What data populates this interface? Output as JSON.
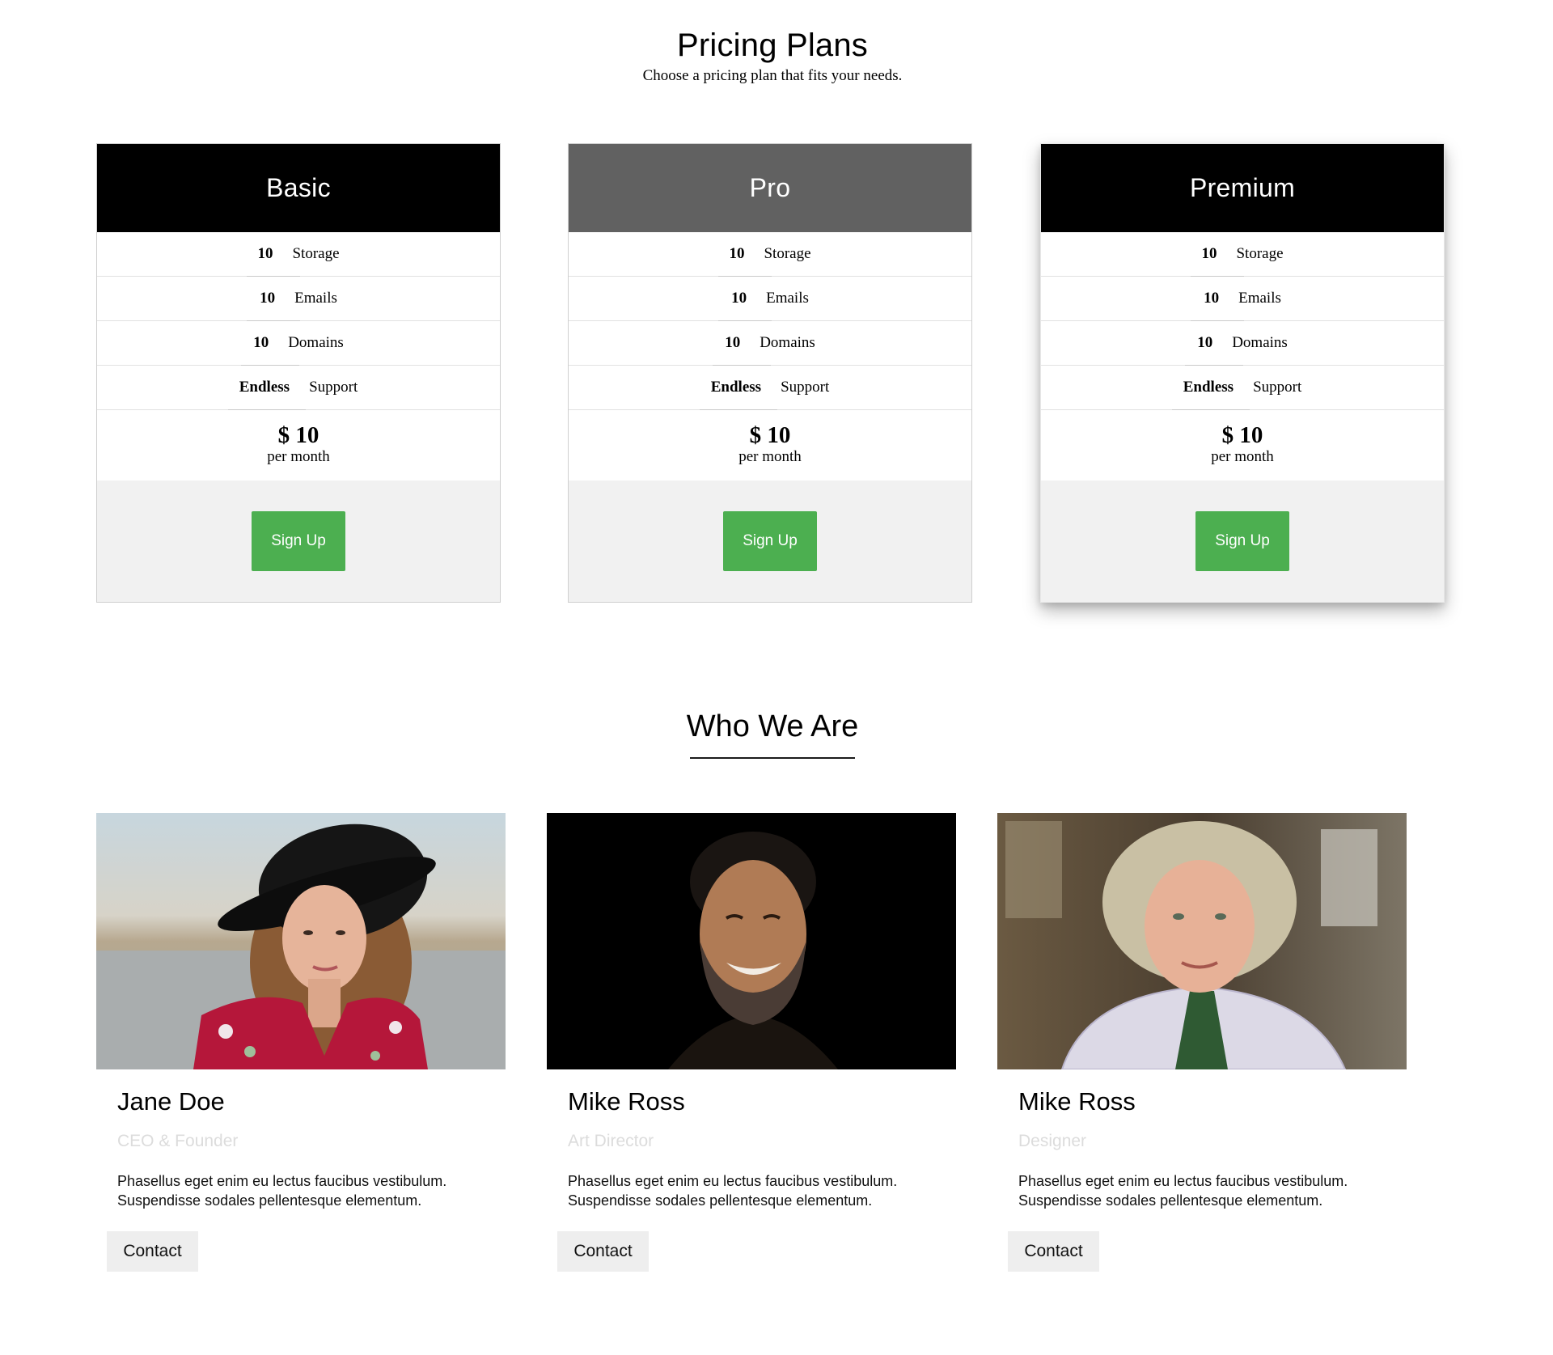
{
  "pricing": {
    "title": "Pricing Plans",
    "subtitle": "Choose a pricing plan that fits your needs.",
    "plans": [
      {
        "name": "Basic",
        "features": [
          {
            "value": "10",
            "label": "Storage"
          },
          {
            "value": "10",
            "label": "Emails"
          },
          {
            "value": "10",
            "label": "Domains"
          },
          {
            "value": "Endless",
            "label": "Support"
          }
        ],
        "price": "$ 10",
        "period": "per month",
        "button": "Sign Up"
      },
      {
        "name": "Pro",
        "features": [
          {
            "value": "10",
            "label": "Storage"
          },
          {
            "value": "10",
            "label": "Emails"
          },
          {
            "value": "10",
            "label": "Domains"
          },
          {
            "value": "Endless",
            "label": "Support"
          }
        ],
        "price": "$ 10",
        "period": "per month",
        "button": "Sign Up"
      },
      {
        "name": "Premium",
        "features": [
          {
            "value": "10",
            "label": "Storage"
          },
          {
            "value": "10",
            "label": "Emails"
          },
          {
            "value": "10",
            "label": "Domains"
          },
          {
            "value": "Endless",
            "label": "Support"
          }
        ],
        "price": "$ 10",
        "period": "per month",
        "button": "Sign Up"
      }
    ],
    "colors": {
      "header_dark": "#000000",
      "header_pro": "#616161",
      "button": "#4caf50",
      "footer_bg": "#f1f1f1"
    }
  },
  "team": {
    "title": "Who We Are",
    "members": [
      {
        "name": "Jane Doe",
        "role": "CEO & Founder",
        "bio": "Phasellus eget enim eu lectus faucibus vestibulum. Suspendisse sodales pellentesque elementum.",
        "button": "Contact"
      },
      {
        "name": "Mike Ross",
        "role": "Art Director",
        "bio": "Phasellus eget enim eu lectus faucibus vestibulum. Suspendisse sodales pellentesque elementum.",
        "button": "Contact"
      },
      {
        "name": "Mike Ross",
        "role": "Designer",
        "bio": "Phasellus eget enim eu lectus faucibus vestibulum. Suspendisse sodales pellentesque elementum.",
        "button": "Contact"
      }
    ]
  }
}
